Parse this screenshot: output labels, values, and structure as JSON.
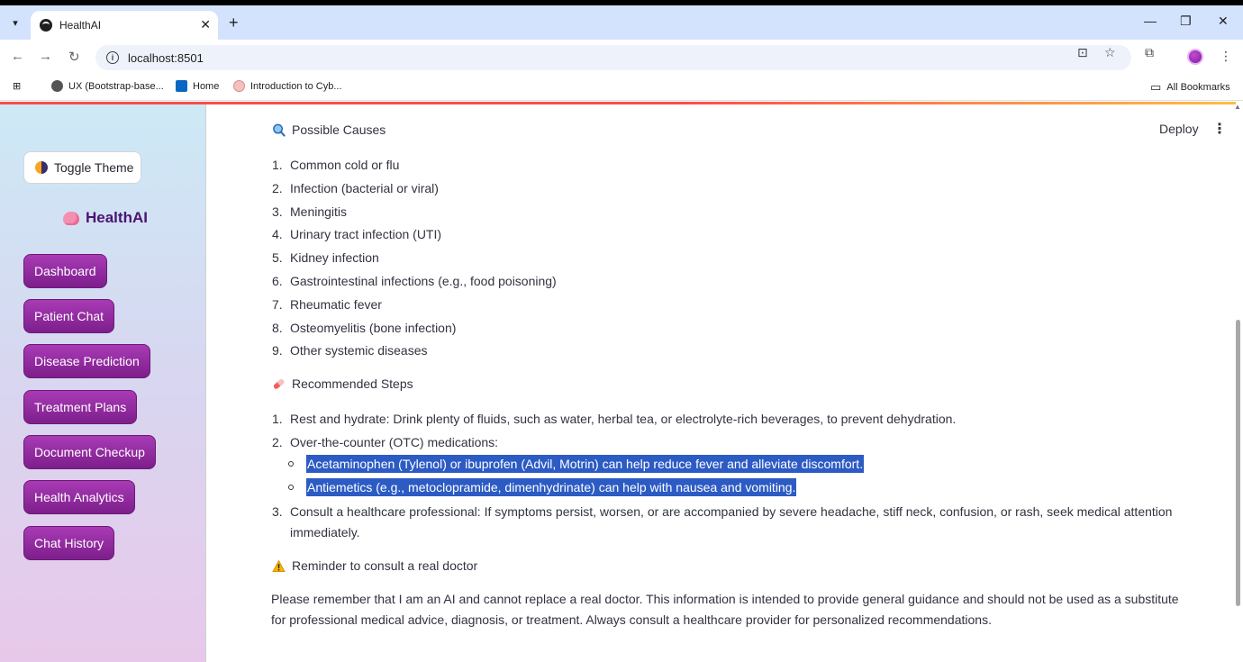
{
  "browser": {
    "tab_title": "HealthAI",
    "url": "localhost:8501",
    "bookmarks": [
      "UX (Bootstrap-base...",
      "Home",
      "Introduction to Cyb..."
    ],
    "all_bookmarks": "All Bookmarks"
  },
  "header": {
    "deploy": "Deploy"
  },
  "sidebar": {
    "toggle_theme": "Toggle Theme",
    "brand": "HealthAI",
    "nav": [
      "Dashboard",
      "Patient Chat",
      "Disease Prediction",
      "Treatment Plans",
      "Document Checkup",
      "Health Analytics",
      "Chat History"
    ]
  },
  "content": {
    "causes_heading": "Possible Causes",
    "causes": [
      "Common cold or flu",
      "Infection (bacterial or viral)",
      "Meningitis",
      "Urinary tract infection (UTI)",
      "Kidney infection",
      "Gastrointestinal infections (e.g., food poisoning)",
      "Rheumatic fever",
      "Osteomyelitis (bone infection)",
      "Other systemic diseases"
    ],
    "steps_heading": "Recommended Steps",
    "steps": {
      "s1": "Rest and hydrate: Drink plenty of fluids, such as water, herbal tea, or electrolyte-rich beverages, to prevent dehydration.",
      "s2": "Over-the-counter (OTC) medications:",
      "s2a": "Acetaminophen (Tylenol) or ibuprofen (Advil, Motrin) can help reduce fever and alleviate discomfort.",
      "s2b": "Antiemetics (e.g., metoclopramide, dimenhydrinate) can help with nausea and vomiting.",
      "s3_line1": "Consult a healthcare professional: If symptoms persist, worsen, or are accompanied by severe headache, stiff neck, confusion, or rash, seek medical attention",
      "s3_line2": "immediately."
    },
    "reminder_heading": "Reminder to consult a real doctor",
    "disclaimer": "Please remember that I am an AI and cannot replace a real doctor. This information is intended to provide general guidance and should not be used as a substitute for professional medical advice, diagnosis, or treatment. Always consult a healthcare provider for personalized recommendations."
  },
  "icons": {
    "causes": "magnifier-icon",
    "steps": "pill-icon",
    "reminder": "warning-icon"
  }
}
